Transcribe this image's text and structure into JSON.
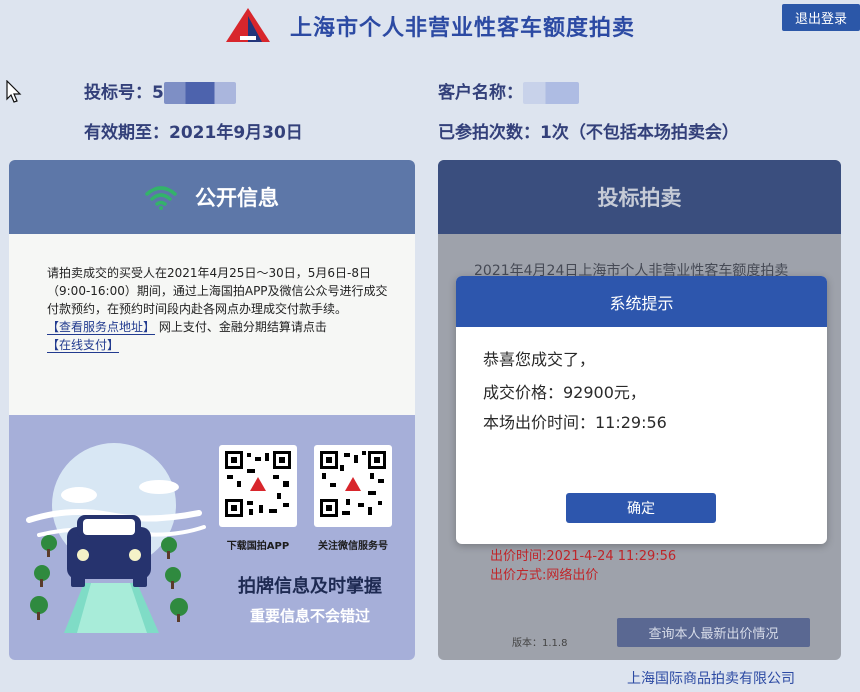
{
  "header": {
    "title": "上海市个人非营业性客车额度拍卖",
    "logout_label": "退出登录",
    "logo_icon": "auction-triangle-logo"
  },
  "bidder_info": {
    "bid_number_label": "投标号：",
    "bid_number_value": "5",
    "customer_name_label": "客户名称：",
    "validity_label": "有效期至：",
    "validity_value": "2021年9月30日",
    "participation_label": "已参拍次数：",
    "participation_value": "1次（不包括本场拍卖会）"
  },
  "public_info": {
    "title": "公开信息",
    "icon": "wifi-icon",
    "notice": "请拍卖成交的买受人在2021年4月25日～30日，5月6日-8日（9:00-16:00）期间，通过上海国拍APP及微信公众号进行成交付款预约，在预约时间段内赴各网点办理成交付款手续。",
    "service_link": "【查看服务点地址】",
    "payment_text": " 网上支付、金融分期结算请点击",
    "online_pay_link": "【在线支付】",
    "qr_app_caption": "下载国拍APP",
    "qr_wechat_caption": "关注微信服务号",
    "promo_title": "拍牌信息及时掌握",
    "promo_subtitle": "重要信息不会错过"
  },
  "bidding": {
    "title": "投标拍卖",
    "auction_line": "2021年4月24日上海市个人非营业性客车额度拍卖",
    "bid_time": "出价时间:2021-4-24 11:29:56",
    "bid_method": "出价方式:网络出价",
    "version": "版本：1.1.8",
    "query_button": "查询本人最新出价情况"
  },
  "modal": {
    "title": "系统提示",
    "line1": "恭喜您成交了，",
    "line2": "成交价格：92900元，",
    "line3": "本场出价时间：11:29:56",
    "ok_label": "确定"
  },
  "footer": {
    "company": "上海国际商品拍卖有限公司"
  },
  "colors": {
    "page_bg": "#dde4ef",
    "primary_blue": "#2d56ad",
    "left_header": "#5d77a8",
    "right_header": "#3a4e7e",
    "wifi_green": "#33b36a",
    "bid_red": "#c0262a"
  }
}
